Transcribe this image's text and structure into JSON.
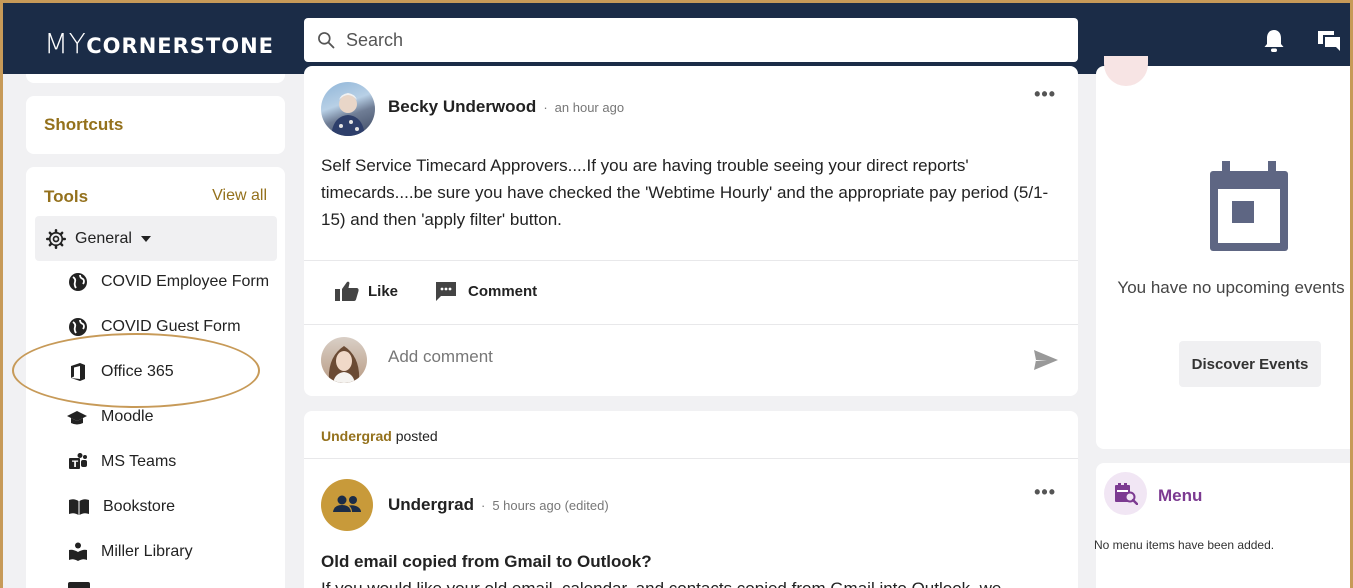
{
  "header": {
    "logo_my": "MY",
    "logo_rest": "CORNERSTONE",
    "search_placeholder": "Search"
  },
  "sidebar": {
    "shortcuts_title": "Shortcuts",
    "tools_title": "Tools",
    "view_all": "View all",
    "general_label": "General",
    "tools": [
      {
        "label": "COVID Employee Form",
        "icon": "globe-icon"
      },
      {
        "label": "COVID Guest Form",
        "icon": "globe-icon"
      },
      {
        "label": "Office 365",
        "icon": "office-icon"
      },
      {
        "label": "Moodle",
        "icon": "graduation-cap-icon"
      },
      {
        "label": "MS Teams",
        "icon": "teams-icon"
      },
      {
        "label": "Bookstore",
        "icon": "book-icon"
      },
      {
        "label": "Miller Library",
        "icon": "library-icon"
      }
    ]
  },
  "feed": {
    "post1": {
      "author": "Becky Underwood",
      "time": "an hour ago",
      "text": "Self Service Timecard Approvers....If you are having trouble seeing your direct reports' timecards....be sure you have checked the 'Webtime Hourly' and the appropriate pay period (5/1-15) and then 'apply filter' button.",
      "like_label": "Like",
      "comment_label": "Comment",
      "comment_placeholder": "Add comment"
    },
    "post2": {
      "posted_by": "Undergrad",
      "posted_suffix": "posted",
      "author": "Undergrad",
      "time": "5 hours ago (edited)",
      "title": "Old email copied from Gmail to Outlook?",
      "text_start": "If you would like your old email, calendar, and contacts copied from Gmail into Outlook, we"
    }
  },
  "events": {
    "empty_text": "You have no upcoming events",
    "discover_label": "Discover Events"
  },
  "menu": {
    "title": "Menu",
    "empty_text": "No menu items have been added."
  },
  "colors": {
    "topbar": "#1b2c47",
    "accent_gold": "#94711c",
    "menu_purple": "#7c3a91",
    "frame": "#c79a58"
  }
}
